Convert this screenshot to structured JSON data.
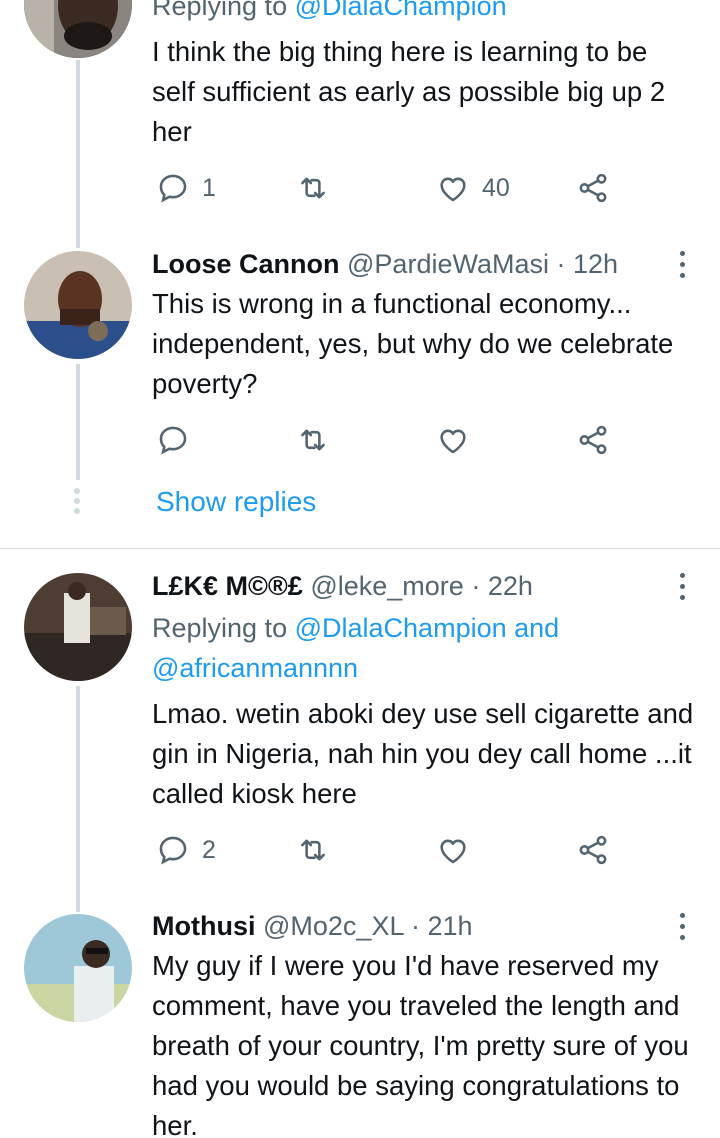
{
  "replies": [
    {
      "id": "r1",
      "replying_prefix": "Replying to",
      "replying_mentions": [
        "@DlalaChampion"
      ],
      "text": "I think the big thing here is learning to be self sufficient as early as possible big up 2 her",
      "actions": {
        "reply_count": "1",
        "retweet_count": "",
        "like_count": "40"
      }
    },
    {
      "id": "r2",
      "display_name": "Loose Cannon",
      "handle": "@PardieWaMasi",
      "time": "12h",
      "text": "This is wrong in a functional economy... independent, yes, but why do we celebrate poverty?",
      "actions": {
        "reply_count": "",
        "retweet_count": "",
        "like_count": ""
      }
    },
    {
      "id": "r3",
      "display_name": "L£K€ M©®£",
      "handle": "@leke_more",
      "time": "22h",
      "replying_prefix": "Replying to",
      "replying_mentions": [
        "@DlalaChampion",
        "and",
        "@africanmannnn"
      ],
      "text": "Lmao. wetin aboki dey use sell cigarette and gin in Nigeria,  nah hin you dey call home ...it called kiosk here",
      "actions": {
        "reply_count": "2",
        "retweet_count": "",
        "like_count": ""
      }
    },
    {
      "id": "r4",
      "display_name": "Mothusi",
      "handle": "@Mo2c_XL",
      "time": "21h",
      "text": "My guy if I were you I'd have reserved my comment, have you traveled the length and breath of your country, I'm pretty sure of you had you would be saying congratulations to her."
    }
  ],
  "show_replies_label": "Show replies",
  "colors": {
    "link": "#1d9bf0",
    "muted": "#536471",
    "text": "#0f1419",
    "thread_line": "#cfd9de"
  },
  "icons": [
    "reply-icon",
    "retweet-icon",
    "like-icon",
    "share-icon",
    "more-icon"
  ]
}
